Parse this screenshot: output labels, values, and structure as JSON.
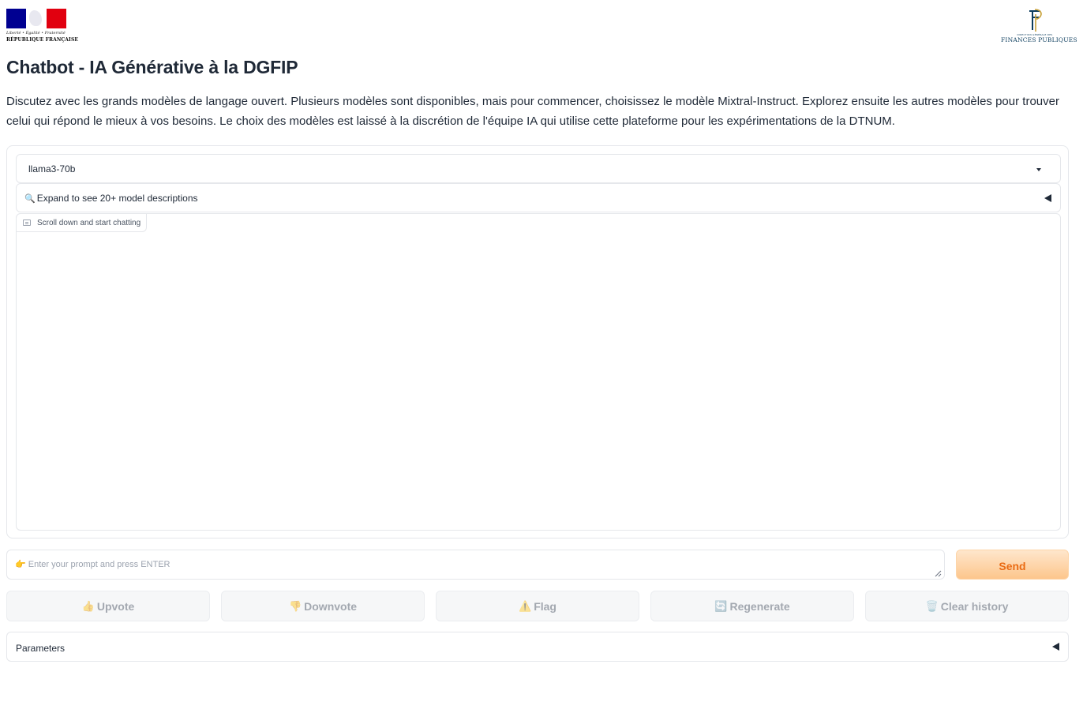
{
  "header": {
    "left_logo": {
      "motto": "Liberté • Égalité • Fraternité",
      "name": "RÉPUBLIQUE FRANÇAISE",
      "colors": [
        "#000091",
        "#ffffff",
        "#e1000f"
      ]
    },
    "right_logo": {
      "small_text": "DIRECTION GÉNÉRALE DES",
      "name": "FINANCES PUBLIQUES",
      "color": "#0b3c5d"
    }
  },
  "page": {
    "title": "Chatbot - IA Générative à la DGFIP",
    "intro": "Discutez avec les grands modèles de langage ouvert. Plusieurs modèles sont disponibles, mais pour commencer, choisissez le modèle Mixtral-Instruct. Explorez ensuite les autres modèles pour trouver celui qui répond le mieux à vos besoins. Le choix des modèles est laissé à la discrétion de l'équipe IA qui utilise cette plateforme pour les expérimentations de la DTNUM."
  },
  "model_select": {
    "value": "llama3-70b",
    "icon": "chevron-down-icon"
  },
  "model_descriptions": {
    "icon": "search-icon",
    "label": "Expand to see 20+ model descriptions",
    "expanded": false
  },
  "chatbot": {
    "label": "Scroll down and start chatting",
    "icon": "chat-icon",
    "messages": []
  },
  "prompt": {
    "placeholder": "👉 Enter your prompt and press ENTER",
    "value": ""
  },
  "send": {
    "label": "Send",
    "accent": "#ea6b14"
  },
  "actions": [
    {
      "emoji": "👍",
      "label": "Upvote"
    },
    {
      "emoji": "👎",
      "label": "Downvote"
    },
    {
      "emoji": "⚠️",
      "label": "Flag"
    },
    {
      "emoji": "🔄",
      "label": "Regenerate"
    },
    {
      "emoji": "🗑️",
      "label": "Clear history"
    }
  ],
  "parameters": {
    "label": "Parameters",
    "expanded": false
  }
}
